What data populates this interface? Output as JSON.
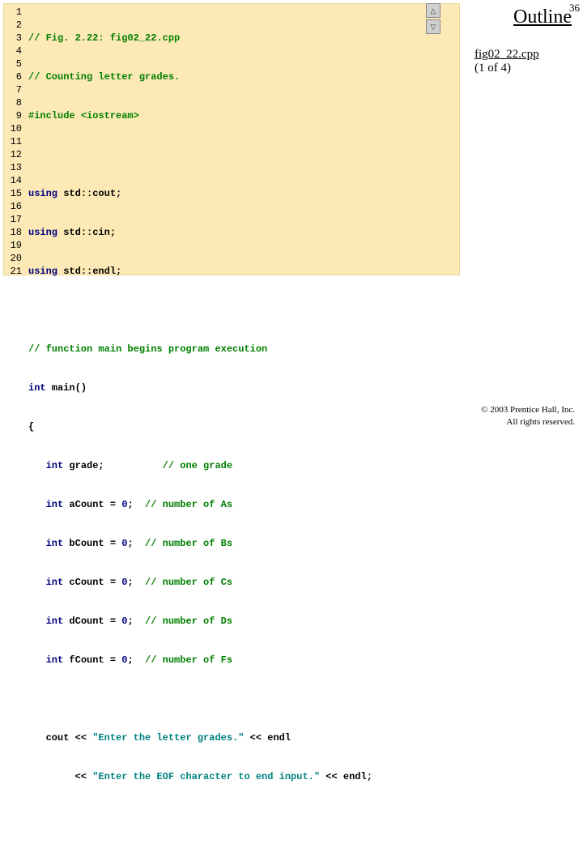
{
  "slide_number": "36",
  "outline_label": "Outline",
  "file_name": "fig02_22.cpp",
  "file_part": "(1 of 4)",
  "copyright_line1": "© 2003 Prentice Hall, Inc.",
  "copyright_line2": "All rights reserved.",
  "nav": {
    "up_glyph": "△",
    "down_glyph": "▽"
  },
  "line_numbers": [
    "1",
    "2",
    "3",
    "4",
    "5",
    "6",
    "7",
    "8",
    "9",
    "10",
    "11",
    "12",
    "13",
    "14",
    "15",
    "16",
    "17",
    "18",
    "19",
    "20",
    "21"
  ],
  "code": {
    "l1": {
      "cm": "// Fig. 2.22: fig02_22.cpp"
    },
    "l2": {
      "cm": "// Counting letter grades."
    },
    "l3": {
      "pp1": "#include ",
      "pp2": "<iostream>"
    },
    "l5a": "using",
    "l5b": " std::cout;",
    "l6a": "using",
    "l6b": " std::cin;",
    "l7a": "using",
    "l7b": " std::endl;",
    "l9": {
      "cm": "// function main begins program execution"
    },
    "l10a": "int",
    "l10b": " main()",
    "l11": "{",
    "l12a": "int",
    "l12b": " grade;          ",
    "l12c": "// one grade",
    "l13a": "int",
    "l13b": " aCount = ",
    "l13n": "0",
    "l13c": ";  ",
    "l13d": "// number of As",
    "l14a": "int",
    "l14b": " bCount = ",
    "l14n": "0",
    "l14c": ";  ",
    "l14d": "// number of Bs",
    "l15a": "int",
    "l15b": " cCount = ",
    "l15n": "0",
    "l15c": ";  ",
    "l15d": "// number of Cs",
    "l16a": "int",
    "l16b": " dCount = ",
    "l16n": "0",
    "l16c": ";  ",
    "l16d": "// number of Ds",
    "l17a": "int",
    "l17b": " fCount = ",
    "l17n": "0",
    "l17c": ";  ",
    "l17d": "// number of Fs",
    "l19a": "   cout << ",
    "l19s": "\"Enter the letter grades.\"",
    "l19b": " << endl",
    "l20a": "        << ",
    "l20s": "\"Enter the EOF character to end input.\"",
    "l20b": " << endl;"
  }
}
